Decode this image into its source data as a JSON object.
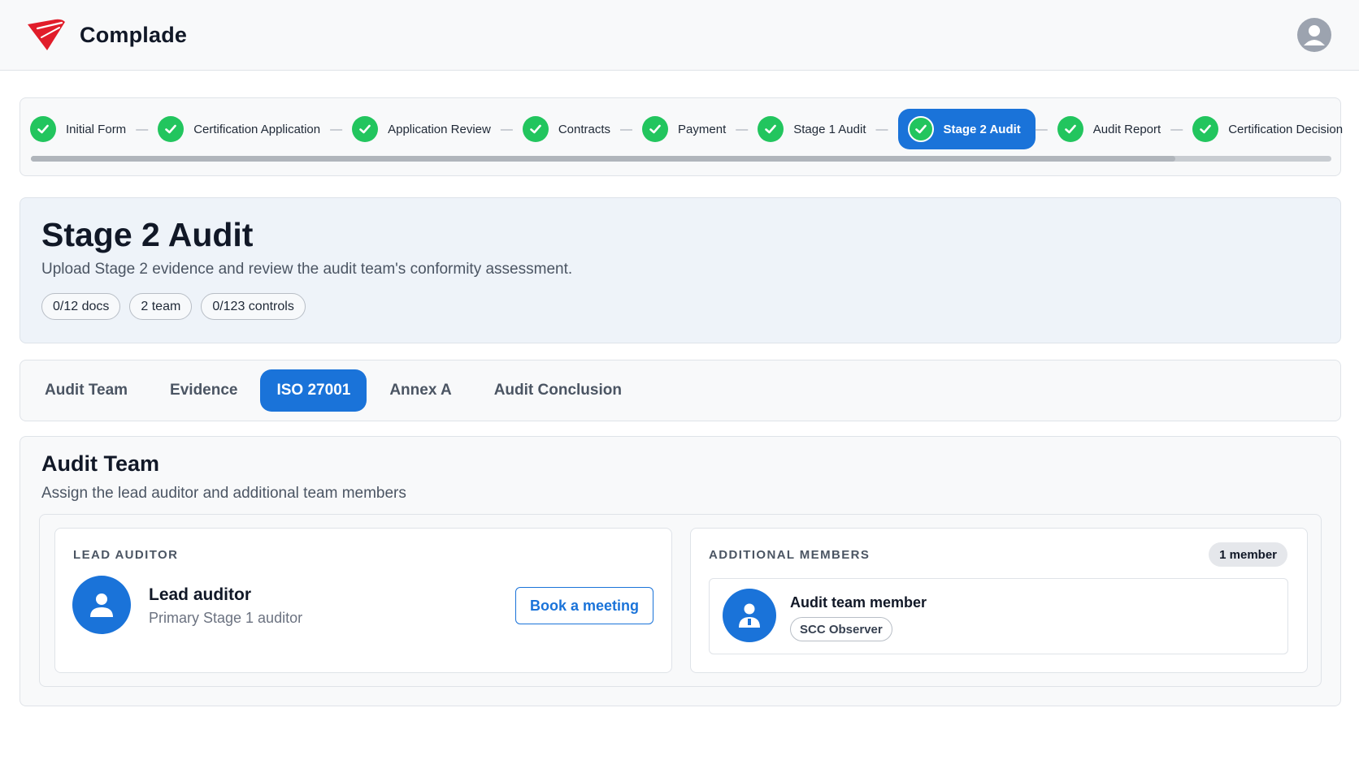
{
  "app": {
    "name": "Complade",
    "brand_color": "#e11d2a",
    "accent_color": "#1a73d9"
  },
  "header": {
    "avatar_icon": "user-icon"
  },
  "stepper": {
    "steps": [
      {
        "label": "Initial Form",
        "status": "complete"
      },
      {
        "label": "Certification Application",
        "status": "complete"
      },
      {
        "label": "Application Review",
        "status": "complete"
      },
      {
        "label": "Contracts",
        "status": "complete"
      },
      {
        "label": "Payment",
        "status": "complete"
      },
      {
        "label": "Stage 1 Audit",
        "status": "complete"
      },
      {
        "label": "Stage 2 Audit",
        "status": "active"
      },
      {
        "label": "Audit Report",
        "status": "complete"
      },
      {
        "label": "Certification Decision",
        "status": "complete"
      }
    ],
    "separator": "—",
    "progress": 0.88
  },
  "page": {
    "title": "Stage 2 Audit",
    "subtitle": "Upload Stage 2 evidence and review the audit team's conformity assessment.",
    "chips": [
      "0/12 docs",
      "2 team",
      "0/123 controls"
    ]
  },
  "tabs": [
    {
      "label": "Audit Team",
      "active": false
    },
    {
      "label": "Evidence",
      "active": false
    },
    {
      "label": "ISO 27001",
      "active": true
    },
    {
      "label": "Annex A",
      "active": false
    },
    {
      "label": "Audit Conclusion",
      "active": false
    }
  ],
  "audit_team": {
    "title": "Audit Team",
    "subtitle": "Assign the lead auditor and additional team members",
    "lead": {
      "section_title": "LEAD AUDITOR",
      "name": "Lead auditor",
      "role": "Primary Stage 1 auditor",
      "button": "Book a meeting"
    },
    "additional": {
      "section_title": "ADDITIONAL MEMBERS",
      "count": "1 member",
      "members": [
        {
          "name": "Audit team member",
          "role": "SCC Observer"
        }
      ]
    }
  }
}
